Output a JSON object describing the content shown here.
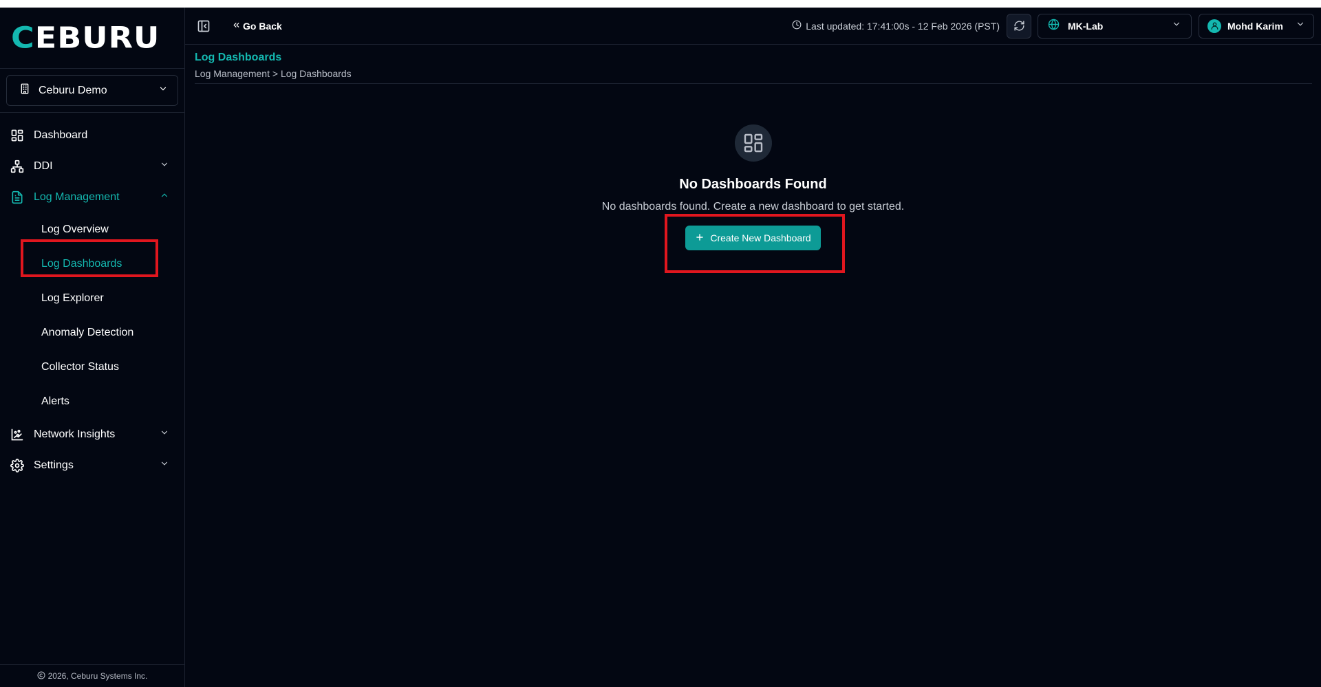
{
  "brand": {
    "logo_text": "CEBURU"
  },
  "org": {
    "selected": "Ceburu Demo"
  },
  "sidebar": {
    "items": [
      {
        "label": "Dashboard"
      },
      {
        "label": "DDI"
      },
      {
        "label": "Log Management"
      },
      {
        "label": "Network Insights"
      },
      {
        "label": "Settings"
      }
    ],
    "log_management_children": [
      {
        "label": "Log Overview"
      },
      {
        "label": "Log Dashboards"
      },
      {
        "label": "Log Explorer"
      },
      {
        "label": "Anomaly Detection"
      },
      {
        "label": "Collector Status"
      },
      {
        "label": "Alerts"
      }
    ]
  },
  "footer": {
    "copyright": "2026, Ceburu Systems Inc."
  },
  "topbar": {
    "go_back": "Go Back",
    "last_updated": "Last updated: 17:41:00s - 12 Feb 2026 (PST)",
    "site": "MK-Lab",
    "user": "Mohd Karim"
  },
  "page": {
    "title": "Log Dashboards",
    "breadcrumb": {
      "parent": "Log Management",
      "separator": ">",
      "current": "Log Dashboards"
    }
  },
  "empty_state": {
    "title": "No Dashboards Found",
    "description": "No dashboards found. Create a new dashboard to get started.",
    "button_label": "Create New Dashboard"
  },
  "colors": {
    "accent": "#14b8b0",
    "button": "#0d9b96",
    "background": "#030712",
    "highlight": "#e0161e"
  }
}
